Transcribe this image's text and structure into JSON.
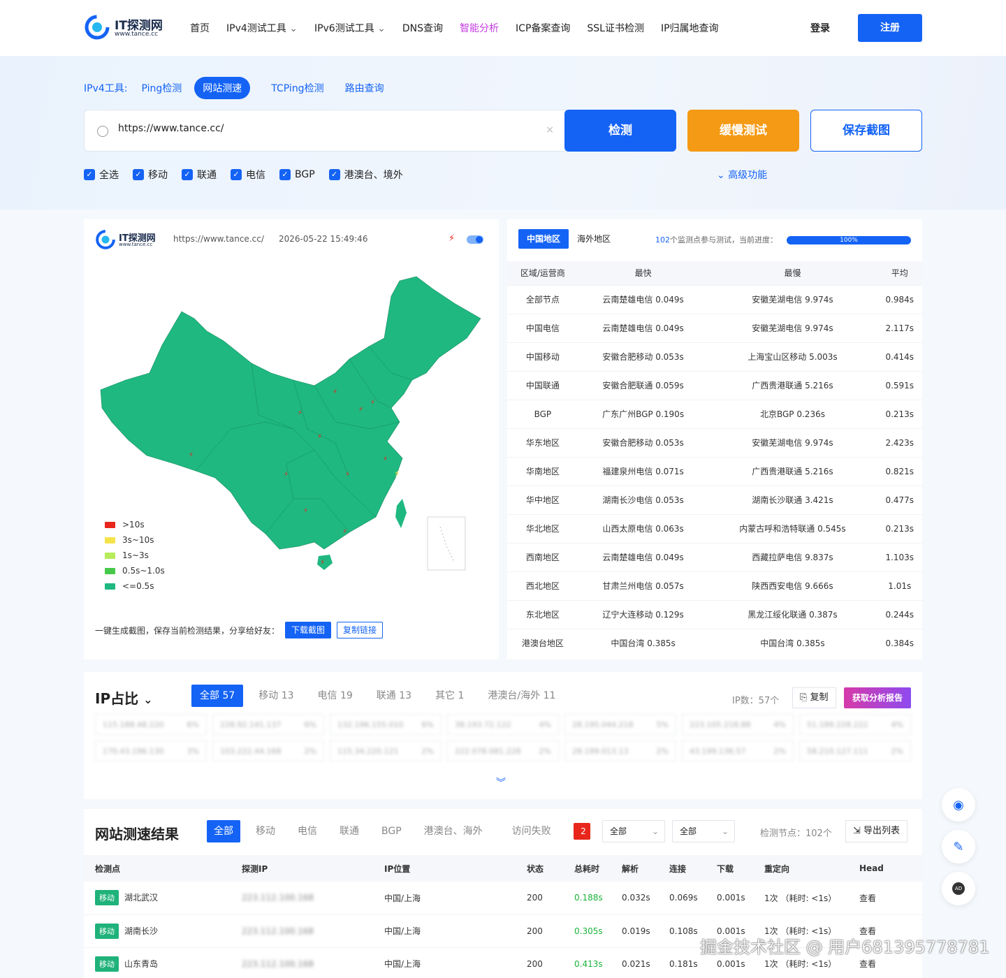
{
  "header": {
    "logo_title": "IT探测网",
    "logo_sub": "www.tance.cc",
    "nav": [
      "首页",
      "IPv4测试工具",
      "IPv6测试工具",
      "DNS查询",
      "智能分析",
      "ICP备案查询",
      "SSL证书检测",
      "IP归属地查询"
    ],
    "login": "登录",
    "register": "注册"
  },
  "tools": {
    "label": "IPv4工具:",
    "tabs": [
      "Ping检测",
      "网站测速",
      "TCPing检测",
      "路由查询"
    ],
    "active": "网站测速"
  },
  "search": {
    "value": "https://www.tance.cc/",
    "clear": "×"
  },
  "buttons": {
    "detect": "检测",
    "slow": "缓慢测试",
    "save": "保存截图"
  },
  "filters": [
    "全选",
    "移动",
    "联通",
    "电信",
    "BGP",
    "港澳台、境外"
  ],
  "advanced": "高级功能",
  "map_panel": {
    "logo_title": "IT探测网",
    "logo_sub": "www.tance.cc",
    "url": "https://www.tance.cc/",
    "time": "2026-05-22 15:49:46",
    "legend": [
      {
        "label": ">10s",
        "color": "#e8261b"
      },
      {
        "label": "3s~10s",
        "color": "#f5e34a"
      },
      {
        "label": "1s~3s",
        "color": "#b7ec5a"
      },
      {
        "label": "0.5s~1.0s",
        "color": "#46c94a"
      },
      {
        "label": "<=0.5s",
        "color": "#1fb881"
      }
    ],
    "share_text": "一键生成截图，保存当前检测结果，分享给好友：",
    "download": "下载截图",
    "copy_link": "复制链接"
  },
  "summary": {
    "tabs": [
      "中国地区",
      "海外地区"
    ],
    "count": "102",
    "count_suffix": "个监测点参与测试，当前进度：",
    "progress": "100%",
    "headers": [
      "区域/运营商",
      "最快",
      "最慢",
      "平均"
    ],
    "rows": [
      [
        "全部节点",
        "云南楚雄电信 0.049s",
        "安徽芜湖电信 9.974s",
        "0.984s"
      ],
      [
        "中国电信",
        "云南楚雄电信 0.049s",
        "安徽芜湖电信 9.974s",
        "2.117s"
      ],
      [
        "中国移动",
        "安徽合肥移动 0.053s",
        "上海宝山区移动 5.003s",
        "0.414s"
      ],
      [
        "中国联通",
        "安徽合肥联通 0.059s",
        "广西贵港联通 5.216s",
        "0.591s"
      ],
      [
        "BGP",
        "广东广州BGP 0.190s",
        "北京BGP 0.236s",
        "0.213s"
      ],
      [
        "华东地区",
        "安徽合肥移动 0.053s",
        "安徽芜湖电信 9.974s",
        "2.423s"
      ],
      [
        "华南地区",
        "福建泉州电信 0.071s",
        "广西贵港联通 5.216s",
        "0.821s"
      ],
      [
        "华中地区",
        "湖南长沙电信 0.053s",
        "湖南长沙联通 3.421s",
        "0.477s"
      ],
      [
        "华北地区",
        "山西太原电信 0.063s",
        "内蒙古呼和浩特联通 0.545s",
        "0.213s"
      ],
      [
        "西南地区",
        "云南楚雄电信 0.049s",
        "西藏拉萨电信 9.837s",
        "1.103s"
      ],
      [
        "西北地区",
        "甘肃兰州电信 0.057s",
        "陕西西安电信 9.666s",
        "1.01s"
      ],
      [
        "东北地区",
        "辽宁大连移动 0.129s",
        "黑龙江绥化联通 0.387s",
        "0.244s"
      ],
      [
        "港澳台地区",
        "中国台湾 0.385s",
        "中国台湾 0.385s",
        "0.384s"
      ]
    ]
  },
  "ip_ratio": {
    "title": "IP占比",
    "tabs": [
      "全部 57",
      "移动 13",
      "电信 19",
      "联通 13",
      "其它 1",
      "港澳台/海外 11"
    ],
    "count": "IP数：57个",
    "copy": "复制",
    "report": "获取分析报告",
    "cells": [
      [
        "115.188.48.220",
        "6%"
      ],
      [
        "228.92.141.137",
        "6%"
      ],
      [
        "132.196.155.010",
        "6%"
      ],
      [
        "38.193.72.122",
        "4%"
      ],
      [
        "28.195.044.218",
        "5%"
      ],
      [
        "223.105.218.88",
        "4%"
      ],
      [
        "51.189.228.222",
        "4%"
      ],
      [
        "170.43.196.130",
        "3%"
      ],
      [
        "103.222.44.168",
        "2%"
      ],
      [
        "115.34.220.121",
        "2%"
      ],
      [
        "222.078.081.228",
        "2%"
      ],
      [
        "28.199.013.13",
        "2%"
      ],
      [
        "43.199.136.57",
        "2%"
      ],
      [
        "58.210.127.111",
        "2%"
      ]
    ]
  },
  "results": {
    "title": "网站测速结果",
    "tabs": [
      "全部",
      "移动",
      "电信",
      "联通",
      "BGP",
      "港澳台、海外",
      "访问失败"
    ],
    "fail_count": "2",
    "select1": "全部",
    "select2": "全部",
    "nodes": "检测节点：102个",
    "export": "导出列表",
    "headers": [
      "检测点",
      "探测IP",
      "IP位置",
      "状态",
      "总耗时",
      "解析",
      "连接",
      "下载",
      "重定向",
      "Head"
    ],
    "rows": [
      {
        "isp": "移动",
        "city": "湖北武汉",
        "ip": "223.112.100.168",
        "loc": "中国/上海",
        "status": "200",
        "total": "0.188s",
        "dns": "0.032s",
        "conn": "0.069s",
        "down": "0.001s",
        "redirect": "1次 （耗时: <1s）",
        "head": "查看"
      },
      {
        "isp": "移动",
        "city": "湖南长沙",
        "ip": "223.112.100.168",
        "loc": "中国/上海",
        "status": "200",
        "total": "0.305s",
        "dns": "0.019s",
        "conn": "0.108s",
        "down": "0.001s",
        "redirect": "1次 （耗时: <1s）",
        "head": "查看"
      },
      {
        "isp": "移动",
        "city": "山东青岛",
        "ip": "223.112.100.168",
        "loc": "中国/上海",
        "status": "200",
        "total": "0.413s",
        "dns": "0.021s",
        "conn": "0.181s",
        "down": "0.001s",
        "redirect": "1次 （耗时: <1s）",
        "head": "查看"
      }
    ]
  },
  "watermark": "掘金技术社区 @ 用户681395778781",
  "colors": {
    "accent": "#1463f5",
    "orange": "#f59a14",
    "map_green": "#1fb881",
    "report_grad": "#d63aa8"
  }
}
